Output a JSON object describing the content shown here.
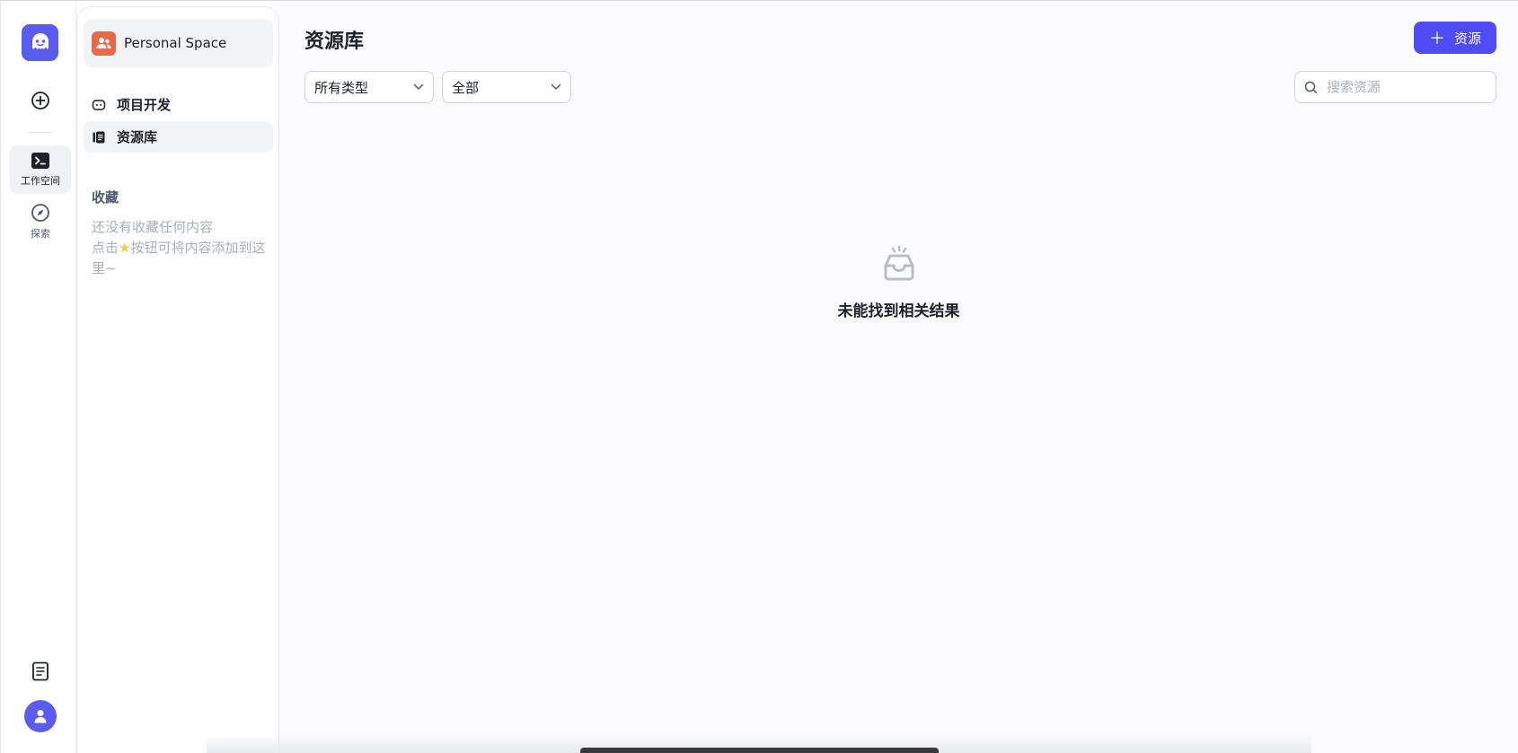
{
  "rail": {
    "logo_icon": "ghost-logo-icon",
    "create_icon": "plus-circle-icon",
    "nav": [
      {
        "label": "工作空间",
        "icon": "terminal-icon",
        "active": true
      },
      {
        "label": "探索",
        "icon": "compass-icon",
        "active": false
      }
    ],
    "docs_icon": "document-icon",
    "avatar_icon": "user-icon"
  },
  "sidebar": {
    "space_name": "Personal Space",
    "items": [
      {
        "label": "项目开发",
        "icon": "bot-icon",
        "active": false
      },
      {
        "label": "资源库",
        "icon": "library-icon",
        "active": true
      }
    ],
    "favorites_title": "收藏",
    "favorites_empty_line1": "还没有收藏任何内容",
    "favorites_empty_line2_prefix": "点击",
    "favorites_empty_line2_suffix": "按钮可将内容添加到这里~"
  },
  "main": {
    "title": "资源库",
    "add_button_label": "资源",
    "filter_type": "所有类型",
    "filter_scope": "全部",
    "search_placeholder": "搜索资源",
    "empty_text": "未能找到相关结果"
  },
  "colors": {
    "accent": "#4e4cf5",
    "space_icon_bg": "#e8684a"
  }
}
